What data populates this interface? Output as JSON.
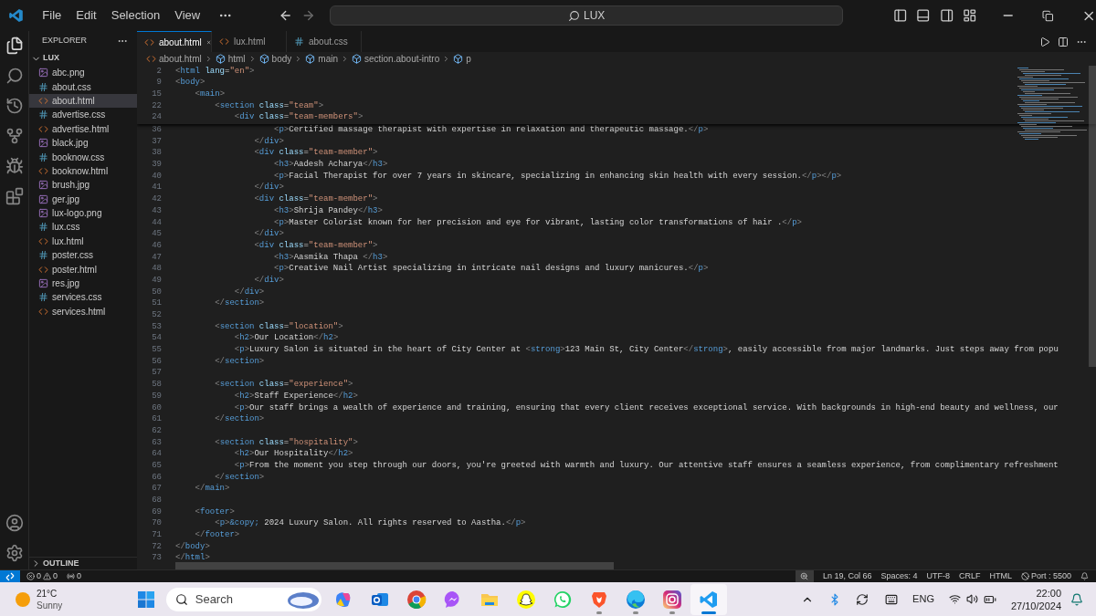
{
  "menu": [
    "File",
    "Edit",
    "Selection",
    "View"
  ],
  "command_center": {
    "value": "LUX"
  },
  "explorer": {
    "title": "EXPLORER",
    "folder": "LUX",
    "outline": "OUTLINE",
    "files": [
      {
        "name": "abc.png",
        "kind": "image",
        "selected": false
      },
      {
        "name": "about.css",
        "kind": "css",
        "selected": false
      },
      {
        "name": "about.html",
        "kind": "html",
        "selected": true
      },
      {
        "name": "advertise.css",
        "kind": "css",
        "selected": false
      },
      {
        "name": "advertise.html",
        "kind": "html",
        "selected": false
      },
      {
        "name": "black.jpg",
        "kind": "image",
        "selected": false
      },
      {
        "name": "booknow.css",
        "kind": "css",
        "selected": false
      },
      {
        "name": "booknow.html",
        "kind": "html",
        "selected": false
      },
      {
        "name": "brush.jpg",
        "kind": "image",
        "selected": false
      },
      {
        "name": "ger.jpg",
        "kind": "image",
        "selected": false
      },
      {
        "name": "lux-logo.png",
        "kind": "image",
        "selected": false
      },
      {
        "name": "lux.css",
        "kind": "css",
        "selected": false
      },
      {
        "name": "lux.html",
        "kind": "html",
        "selected": false
      },
      {
        "name": "poster.css",
        "kind": "css",
        "selected": false
      },
      {
        "name": "poster.html",
        "kind": "html",
        "selected": false
      },
      {
        "name": "res.jpg",
        "kind": "image",
        "selected": false
      },
      {
        "name": "services.css",
        "kind": "css",
        "selected": false
      },
      {
        "name": "services.html",
        "kind": "html",
        "selected": false
      }
    ]
  },
  "tabs": [
    {
      "label": "about.html",
      "kind": "html",
      "selected": true
    },
    {
      "label": "lux.html",
      "kind": "html",
      "selected": false
    },
    {
      "label": "about.css",
      "kind": "css",
      "selected": false
    }
  ],
  "breadcrumb": [
    {
      "label": "about.html",
      "kind": "file"
    },
    {
      "label": "html",
      "kind": "symbol"
    },
    {
      "label": "body",
      "kind": "symbol"
    },
    {
      "label": "main",
      "kind": "symbol"
    },
    {
      "label": "section.about-intro",
      "kind": "symbol"
    },
    {
      "label": "p",
      "kind": "symbol"
    }
  ],
  "sticky_lines": [
    {
      "n": "2",
      "code": "<html lang=\"en\">"
    },
    {
      "n": "9",
      "code": "<body>"
    },
    {
      "n": "15",
      "code": "    <main>"
    },
    {
      "n": "22",
      "code": "        <section class=\"team\">"
    },
    {
      "n": "24",
      "code": "            <div class=\"team-members\">"
    }
  ],
  "lines": [
    {
      "n": "36",
      "code": "                    <p>Certified massage therapist with expertise in relaxation and therapeutic massage.</p>"
    },
    {
      "n": "37",
      "code": "                </div>"
    },
    {
      "n": "38",
      "code": "                <div class=\"team-member\">"
    },
    {
      "n": "39",
      "code": "                    <h3>Aadesh Acharya</h3>"
    },
    {
      "n": "40",
      "code": "                    <p>Facial Therapist for over 7 years in skincare, specializing in enhancing skin health with every session.</p></p>"
    },
    {
      "n": "41",
      "code": "                </div>"
    },
    {
      "n": "42",
      "code": "                <div class=\"team-member\">"
    },
    {
      "n": "43",
      "code": "                    <h3>Shrija Pandey</h3>"
    },
    {
      "n": "44",
      "code": "                    <p>Master Colorist known for her precision and eye for vibrant, lasting color transformations of hair .</p>"
    },
    {
      "n": "45",
      "code": "                </div>"
    },
    {
      "n": "46",
      "code": "                <div class=\"team-member\">"
    },
    {
      "n": "47",
      "code": "                    <h3>Aasmika Thapa </h3>"
    },
    {
      "n": "48",
      "code": "                    <p>Creative Nail Artist specializing in intricate nail designs and luxury manicures.</p>"
    },
    {
      "n": "49",
      "code": "                </div>"
    },
    {
      "n": "50",
      "code": "            </div>"
    },
    {
      "n": "51",
      "code": "        </section>"
    },
    {
      "n": "52"
    },
    {
      "n": "53",
      "code": "        <section class=\"location\">"
    },
    {
      "n": "54",
      "code": "            <h2>Our Location</h2>"
    },
    {
      "n": "55",
      "code": "            <p>Luxury Salon is situated in the heart of City Center at <strong>123 Main St, City Center</strong>, easily accessible from major landmarks. Just steps away from popu"
    },
    {
      "n": "56",
      "code": "        </section>"
    },
    {
      "n": "57"
    },
    {
      "n": "58",
      "code": "        <section class=\"experience\">"
    },
    {
      "n": "59",
      "code": "            <h2>Staff Experience</h2>"
    },
    {
      "n": "60",
      "code": "            <p>Our staff brings a wealth of experience and training, ensuring that every client receives exceptional service. With backgrounds in high-end beauty and wellness, our"
    },
    {
      "n": "61",
      "code": "        </section>"
    },
    {
      "n": "62"
    },
    {
      "n": "63",
      "code": "        <section class=\"hospitality\">"
    },
    {
      "n": "64",
      "code": "            <h2>Our Hospitality</h2>"
    },
    {
      "n": "65",
      "code": "            <p>From the moment you step through our doors, you're greeted with warmth and luxury. Our attentive staff ensures a seamless experience, from complimentary refreshment"
    },
    {
      "n": "66",
      "code": "        </section>"
    },
    {
      "n": "67",
      "code": "    </main>"
    },
    {
      "n": "68"
    },
    {
      "n": "69",
      "code": "    <footer>"
    },
    {
      "n": "70",
      "code": "        <p>&copy; 2024 Luxury Salon. All rights reserved to Aastha.</p>"
    },
    {
      "n": "71",
      "code": "    </footer>"
    },
    {
      "n": "72",
      "code": "</body>"
    },
    {
      "n": "73",
      "code": "</html>"
    }
  ],
  "status_bar": {
    "errors": "0",
    "warnings": "0",
    "ports": "0",
    "position": "Ln 19, Col 66",
    "spaces": "Spaces: 4",
    "encoding": "UTF-8",
    "eol": "CRLF",
    "language": "HTML",
    "port": "Port : 5500"
  },
  "taskbar": {
    "temperature": "21°C",
    "weather": "Sunny",
    "search_placeholder": "Search",
    "apps": [
      {
        "kind": "copilot",
        "running": false,
        "selected": false
      },
      {
        "kind": "outlook",
        "running": false,
        "selected": false
      },
      {
        "kind": "chrome",
        "running": false,
        "selected": false
      },
      {
        "kind": "messenger",
        "running": false,
        "selected": false
      },
      {
        "kind": "files",
        "running": false,
        "selected": false
      },
      {
        "kind": "snapchat",
        "running": false,
        "selected": false
      },
      {
        "kind": "whatsapp",
        "running": false,
        "selected": false
      },
      {
        "kind": "brave",
        "running": true,
        "selected": false
      },
      {
        "kind": "edge",
        "running": true,
        "selected": false
      },
      {
        "kind": "instagram",
        "running": true,
        "selected": false
      },
      {
        "kind": "vscode",
        "running": true,
        "selected": true
      }
    ],
    "language": "ENG",
    "time": "22:00",
    "date": "27/10/2024"
  }
}
